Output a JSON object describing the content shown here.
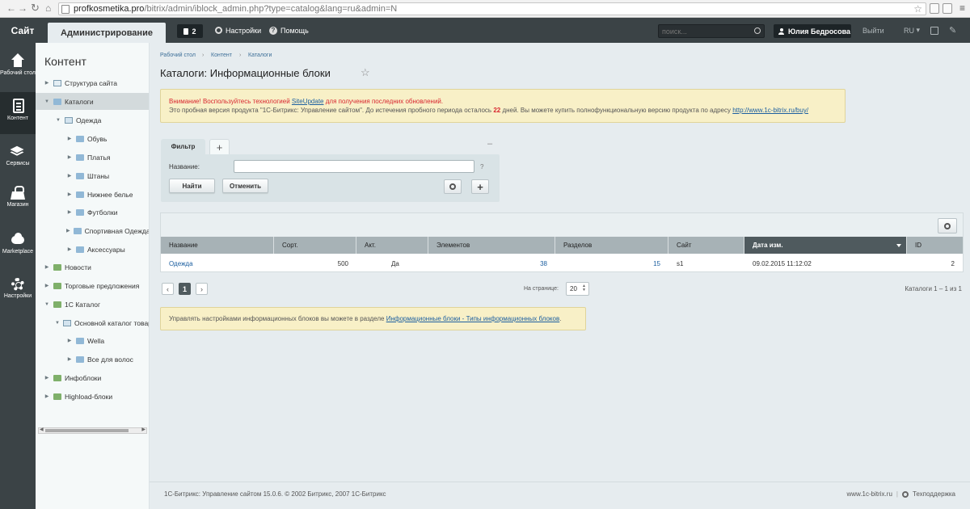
{
  "browser": {
    "url_host": "profkosmetika.pro",
    "url_path": "/bitrix/admin/iblock_admin.php?type=catalog&lang=ru&admin=N"
  },
  "topbar": {
    "site": "Сайт",
    "admin": "Администрирование",
    "notifications": "2",
    "settings": "Настройки",
    "help": "Помощь",
    "search_placeholder": "поиск...",
    "user": "Юлия Бедросова",
    "logout": "Выйти",
    "lang": "RU"
  },
  "leftnav": [
    {
      "label": "Рабочий стол",
      "icon": "home-icon"
    },
    {
      "label": "Контент",
      "icon": "document-icon"
    },
    {
      "label": "Сервисы",
      "icon": "layers-icon"
    },
    {
      "label": "Магазин",
      "icon": "basket-icon"
    },
    {
      "label": "Marketplace",
      "icon": "cloud-icon"
    },
    {
      "label": "Настройки",
      "icon": "gear-icon"
    }
  ],
  "tree": {
    "title": "Контент",
    "items": [
      {
        "label": "Структура сайта"
      },
      {
        "label": "Каталоги"
      },
      {
        "label": "Одежда"
      },
      {
        "label": "Обувь"
      },
      {
        "label": "Платья"
      },
      {
        "label": "Штаны"
      },
      {
        "label": "Нижнее белье"
      },
      {
        "label": "Футболки"
      },
      {
        "label": "Спортивная Одежда"
      },
      {
        "label": "Аксессуары"
      },
      {
        "label": "Новости"
      },
      {
        "label": "Торговые предложения"
      },
      {
        "label": "1С Каталог"
      },
      {
        "label": "Основной каталог товаров"
      },
      {
        "label": "Wella"
      },
      {
        "label": "Все для волос"
      },
      {
        "label": "Инфоблоки"
      },
      {
        "label": "Highload-блоки"
      }
    ]
  },
  "breadcrumb": [
    "Рабочий стол",
    "Контент",
    "Каталоги"
  ],
  "page_title": "Каталоги: Информационные блоки",
  "warning": {
    "l1_a": "Внимание! Воспользуйтесь технологией ",
    "l1_link": "SiteUpdate",
    "l1_b": " для получения последних обновлений.",
    "l2_a": "Это пробная версия продукта \"1С-Битрикс: Управление сайтом\". До истечения пробного периода осталось ",
    "l2_days": "22",
    "l2_b": " дней. Вы можете купить полнофункциональную версию продукта по адресу ",
    "l2_link": "http://www.1c-bitrix.ru/buy/"
  },
  "filter": {
    "tab": "Фильтр",
    "add": "+",
    "minimize": "–",
    "name_label": "Название:",
    "name_value": "",
    "help": "?",
    "find": "Найти",
    "cancel": "Отменить"
  },
  "grid": {
    "columns": [
      "Название",
      "Сорт.",
      "Акт.",
      "Элементов",
      "Разделов",
      "Сайт",
      "Дата изм.",
      "ID"
    ],
    "rows": [
      {
        "name": "Одежда",
        "sort": "500",
        "active": "Да",
        "elements": "38",
        "sections": "15",
        "site": "s1",
        "date": "09.02.2015 11:12:02",
        "id": "2"
      }
    ]
  },
  "pagination": {
    "prev": "‹",
    "current": "1",
    "next": "›",
    "per_page_label": "На странице:",
    "per_page": "20",
    "total": "Каталоги 1 – 1 из 1"
  },
  "info": {
    "text": "Управлять настройками информационных блоков вы можете в разделе ",
    "link": "Информационные блоки - Типы информационных блоков",
    "end": "."
  },
  "footer": {
    "copyright": "1С-Битрикс: Управление сайтом 15.0.6. © 2002 Битрикс, 2007 1С-Битрикс",
    "site_link": "www.1c-bitrix.ru",
    "support": "Техподдержка"
  }
}
